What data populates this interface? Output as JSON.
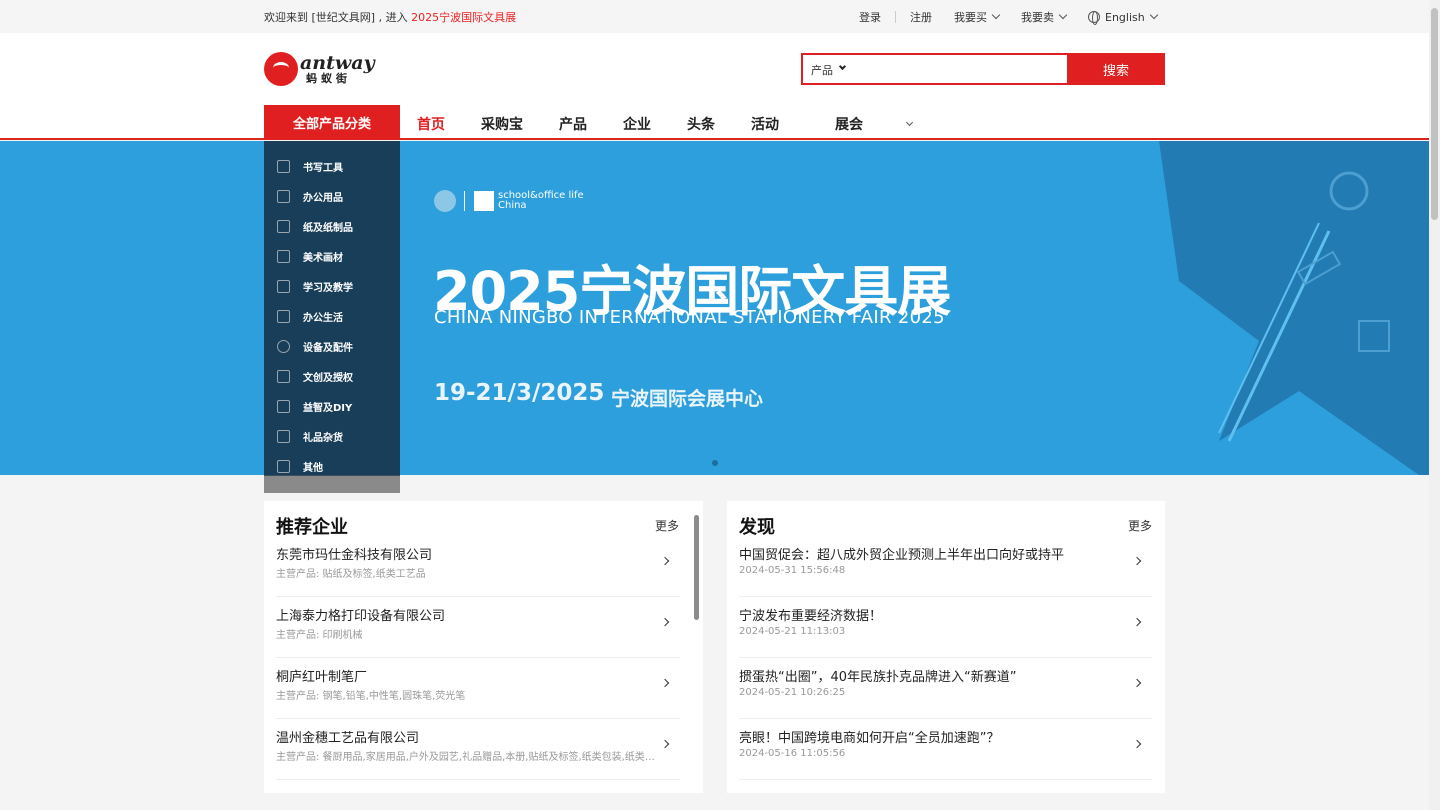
{
  "topbar": {
    "welcome_prefix": "欢迎来到 [世纪文具网] , 进入 ",
    "welcome_link": "2025宁波国际文具展",
    "login": "登录",
    "register": "注册",
    "buy": "我要买",
    "sell": "我要卖",
    "language": "English"
  },
  "header": {
    "logo_en": "antway",
    "logo_cn": "蚂蚁街",
    "search_scope": "产品",
    "search_placeholder": "",
    "search_button": "搜索"
  },
  "nav": {
    "all_categories": "全部产品分类",
    "items": [
      "首页",
      "采购宝",
      "产品",
      "企业",
      "头条",
      "活动",
      "展会"
    ],
    "active_index": 0
  },
  "categories": [
    {
      "label": "书写工具",
      "icon": "pen-icon"
    },
    {
      "label": "办公用品",
      "icon": "stapler-icon"
    },
    {
      "label": "纸及纸制品",
      "icon": "notebook-icon"
    },
    {
      "label": "美术画材",
      "icon": "palette-icon"
    },
    {
      "label": "学习及教学",
      "icon": "bottle-icon"
    },
    {
      "label": "办公生活",
      "icon": "cup-icon"
    },
    {
      "label": "设备及配件",
      "icon": "disc-icon"
    },
    {
      "label": "文创及授权",
      "icon": "mask-icon"
    },
    {
      "label": "益智及DIY",
      "icon": "tools-icon"
    },
    {
      "label": "礼品杂货",
      "icon": "gift-icon"
    },
    {
      "label": "其他",
      "icon": "grid-icon"
    }
  ],
  "banner": {
    "logo_text_1": "school&office life",
    "logo_text_2": "China",
    "title": "2025宁波国际文具展",
    "subtitle": "CHINA NINGBO INTERNATIONAL STATIONERY FAIR 2025",
    "date": "19-21/3/2025",
    "venue": "宁波国际会展中心",
    "bg_color": "#2d9fdc"
  },
  "recommended": {
    "title": "推荐企业",
    "more": "更多",
    "items": [
      {
        "name": "东莞市玛仕金科技有限公司",
        "desc": "主营产品: 贴纸及标签,纸类工艺品"
      },
      {
        "name": "上海泰力格打印设备有限公司",
        "desc": "主营产品: 印刷机械"
      },
      {
        "name": "桐庐红叶制笔厂",
        "desc": "主营产品: 钢笔,铅笔,中性笔,圆珠笔,荧光笔"
      },
      {
        "name": "温州金穗工艺品有限公司",
        "desc": "主营产品: 餐厨用品,家居用品,户外及园艺,礼品赠品,本册,贴纸及标签,纸类包装,纸类工艺品"
      }
    ]
  },
  "discover": {
    "title": "发现",
    "more": "更多",
    "items": [
      {
        "title": "中国贸促会：超八成外贸企业预测上半年出口向好或持平",
        "time": "2024-05-31 15:56:48"
      },
      {
        "title": "宁波发布重要经济数据！",
        "time": "2024-05-21 11:13:03"
      },
      {
        "title": "掼蛋热“出圈”，40年民族扑克品牌进入“新赛道”",
        "time": "2024-05-21 10:26:25"
      },
      {
        "title": "亮眼！中国跨境电商如何开启“全员加速跑”？",
        "time": "2024-05-16 11:05:56"
      }
    ]
  },
  "colors": {
    "brand_red": "#e02020",
    "banner_blue": "#2d9fdc"
  }
}
